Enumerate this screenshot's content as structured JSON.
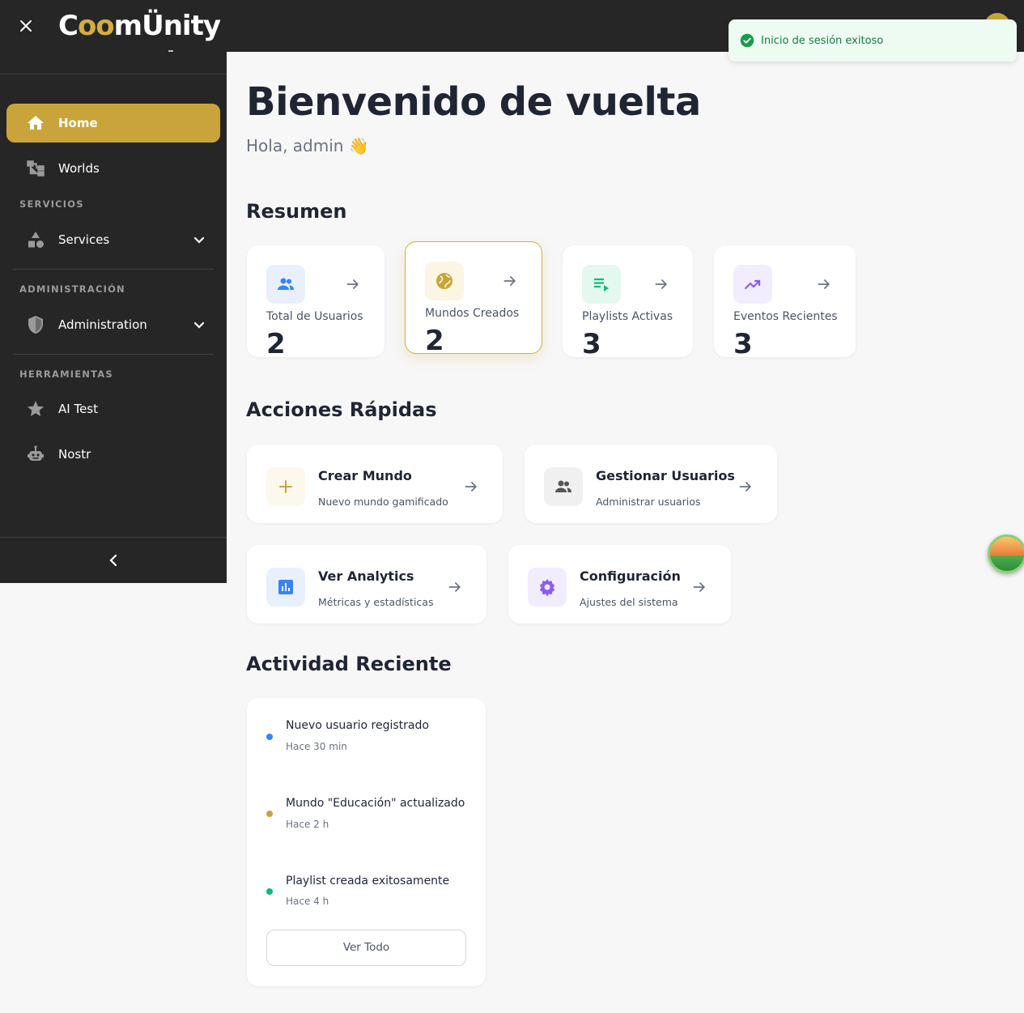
{
  "app": {
    "logo_text": "CoomÜnity"
  },
  "toast": {
    "message": "Inicio de sesión exitoso"
  },
  "sidebar": {
    "items": [
      {
        "label": "Home",
        "icon": "home-icon",
        "active": true
      },
      {
        "label": "Worlds",
        "icon": "tree-structure-icon"
      }
    ],
    "sections": [
      {
        "title": "SERVICIOS",
        "items": [
          {
            "label": "Services",
            "icon": "shapes-icon",
            "expandable": true
          }
        ]
      },
      {
        "title": "ADMINISTRACIÓN",
        "items": [
          {
            "label": "Administration",
            "icon": "shield-icon",
            "expandable": true
          }
        ]
      },
      {
        "title": "HERRAMIENTAS",
        "items": [
          {
            "label": "AI Test",
            "icon": "star-icon"
          },
          {
            "label": "Nostr",
            "icon": "robot-icon"
          }
        ]
      }
    ]
  },
  "main": {
    "title": "Bienvenido de vuelta",
    "greeting": "Hola, admin 👋",
    "summary_title": "Resumen",
    "stats": [
      {
        "label": "Total de Usuarios",
        "value": "2",
        "icon": "users-icon",
        "color": "#3b82f6"
      },
      {
        "label": "Mundos Creados",
        "value": "2",
        "icon": "globe-icon",
        "color": "#c9a43a"
      },
      {
        "label": "Playlists Activas",
        "value": "3",
        "icon": "playlist-icon",
        "color": "#10b981"
      },
      {
        "label": "Eventos Recientes",
        "value": "3",
        "icon": "trending-up-icon",
        "color": "#8b5cf6"
      }
    ],
    "quick_title": "Acciones Rápidas",
    "quick_actions": [
      {
        "title": "Crear Mundo",
        "subtitle": "Nuevo mundo gamificado",
        "icon": "plus-icon"
      },
      {
        "title": "Gestionar Usuarios",
        "subtitle": "Administrar usuarios",
        "icon": "users-icon"
      },
      {
        "title": "Ver Analytics",
        "subtitle": "Métricas y estadísticas",
        "icon": "bar-chart-icon"
      },
      {
        "title": "Configuración",
        "subtitle": "Ajustes del sistema",
        "icon": "gear-icon"
      }
    ],
    "activity_title": "Actividad Reciente",
    "activity": [
      {
        "title": "Nuevo usuario registrado",
        "time": "Hace 30 min",
        "color": "#3b82f6"
      },
      {
        "title": "Mundo \"Educación\" actualizado",
        "time": "Hace 2 h",
        "color": "#c9a43a"
      },
      {
        "title": "Playlist creada exitosamente",
        "time": "Hace 4 h",
        "color": "#10b981"
      }
    ],
    "view_all_label": "Ver Todo"
  },
  "colors": {
    "accent": "#c9a43a",
    "sidebar_bg": "#262626",
    "page_bg": "#f7f7f8"
  }
}
